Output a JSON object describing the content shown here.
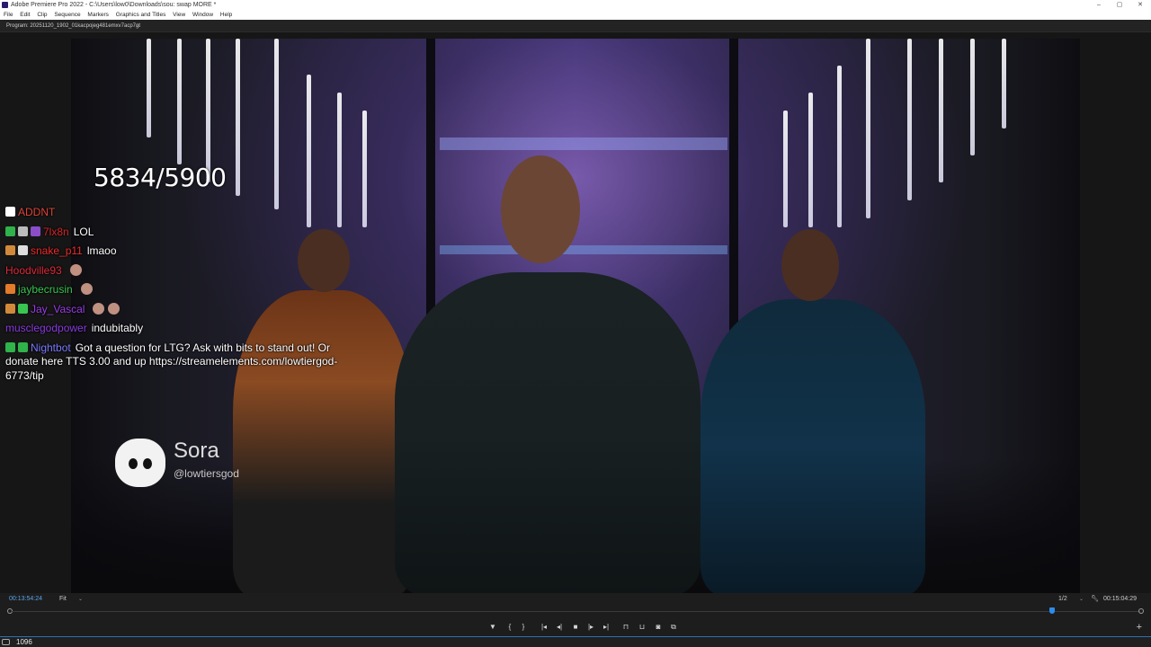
{
  "window": {
    "title": "Adobe Premiere Pro 2022 - C:\\Users\\low0\\Downloads\\sou: swap MORE *",
    "controls": [
      "–",
      "▢",
      "✕"
    ]
  },
  "menu": [
    "File",
    "Edit",
    "Clip",
    "Sequence",
    "Markers",
    "Graphics and Titles",
    "View",
    "Window",
    "Help"
  ],
  "panel": {
    "label": "Program: 20251120_1902_01kacpojeg481emxv7acp7gt",
    "menu_glyph": "≡"
  },
  "overlay": {
    "counter": "5834/5900"
  },
  "chat": [
    {
      "user": "ADDNT",
      "msg": "",
      "user_color": "#e0443a",
      "badges": [
        "#ffffff"
      ],
      "emotes": 0
    },
    {
      "user": "7lx8n",
      "msg": "LOL",
      "user_color": "#d7262c",
      "badges": [
        "#2fb34a",
        "#bbbbbb",
        "#8b4ec8"
      ],
      "emotes": 0
    },
    {
      "user": "snake_p11",
      "msg": "lmaoo",
      "user_color": "#ef2b2b",
      "badges": [
        "#d28a3a",
        "#dddddd"
      ],
      "emotes": 0
    },
    {
      "user": "Hoodville93",
      "msg": "",
      "user_color": "#e0293a",
      "badges": [],
      "emotes": 1
    },
    {
      "user": "jaybecrusin",
      "msg": "",
      "user_color": "#39c552",
      "badges": [
        "#e27b2a"
      ],
      "emotes": 1
    },
    {
      "user": "Jay_Vascal",
      "msg": "",
      "user_color": "#9b3ee8",
      "badges": [
        "#d28a3a",
        "#39c552"
      ],
      "emotes": 2
    },
    {
      "user": "musclegodpower",
      "msg": "indubitably",
      "user_color": "#8b3be0",
      "badges": [],
      "emotes": 0
    }
  ],
  "nightbot": {
    "user": "Nightbot",
    "user_color": "#7b79ff",
    "badges": [
      "#2fb34a",
      "#2fb34a"
    ],
    "msg": "Got a question for LTG? Ask with bits to stand out! Or donate here TTS 3.00 and up https://streamelements.com/lowtiergod-6773/tip"
  },
  "watermark": {
    "name": "Sora",
    "handle": "@lowtiersgod"
  },
  "timebar": {
    "timecode_current": "00:13:54:24",
    "fit": "Fit",
    "resolution": "1/2",
    "timecode_duration": "00:15:04:29",
    "playhead_fraction": 0.922
  },
  "transport": [
    "marker-icon",
    "mark-in-icon",
    "mark-out-icon",
    "go-to-in-icon",
    "step-back-icon",
    "stop-icon",
    "step-forward-icon",
    "go-to-out-icon",
    "insert-icon",
    "overwrite-icon",
    "camera-icon",
    "compare-icon"
  ],
  "status": {
    "value": "1096"
  },
  "colors": {
    "accent": "#2d8ceb",
    "timecode": "#5aa6e6"
  }
}
